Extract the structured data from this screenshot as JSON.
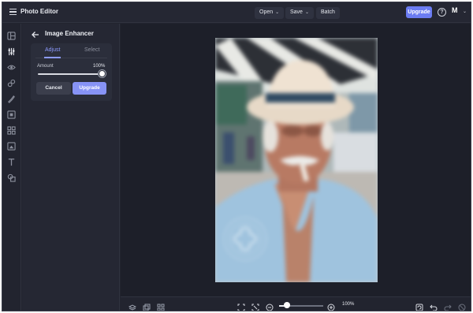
{
  "header": {
    "app_title": "Photo Editor",
    "menus": [
      {
        "label": "Open"
      },
      {
        "label": "Save"
      },
      {
        "label": "Batch"
      }
    ],
    "upgrade_label": "Upgrade",
    "help_label": "?",
    "avatar_initial": "M"
  },
  "rail": {
    "icons": [
      "layout-icon",
      "adjust-sliders-icon",
      "eye-icon",
      "effects-icon",
      "paint-icon",
      "frame-icon",
      "elements-icon",
      "overlay-icon",
      "text-icon",
      "textures-icon"
    ],
    "active": "adjust-sliders-icon"
  },
  "panel": {
    "title": "Image Enhancer",
    "tabs": [
      {
        "label": "Adjust",
        "active": true
      },
      {
        "label": "Select",
        "active": false
      }
    ],
    "amount_label": "Amount",
    "amount_value": "100%",
    "amount_fraction": 1.0,
    "cancel_label": "Cancel",
    "upgrade_label": "Upgrade"
  },
  "canvas": {
    "image_description_icon": "photo",
    "watermark_icon": "watermark-badge-icon"
  },
  "footer": {
    "zoom_value": "100%",
    "zoom_fraction": 0.15
  },
  "colors": {
    "accent": "#6b7cf2",
    "background": "#22242f",
    "canvas": "#1d1f29"
  }
}
